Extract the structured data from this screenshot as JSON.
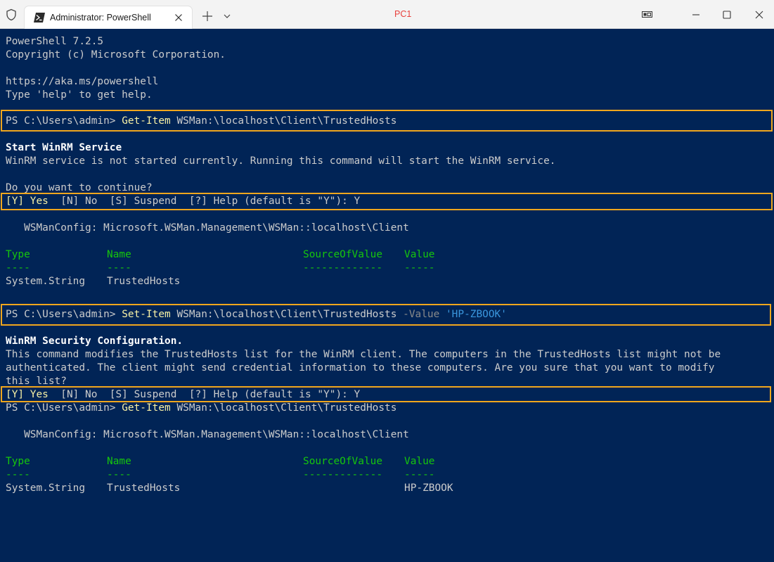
{
  "window": {
    "tab_title": "Administrator: PowerShell",
    "title": "PC1"
  },
  "icons": [
    "shield-icon",
    "powershell-icon",
    "close-icon",
    "plus-icon",
    "chevron-down-icon",
    "snap-icon",
    "minimize-icon",
    "maximize-icon",
    "close-icon"
  ],
  "colors": {
    "background": "#012456",
    "highlight": "#f0a61d",
    "command": "#f9f1a5",
    "header": "#16c60c",
    "string": "#3a96dd",
    "title": "#e8403c"
  },
  "console": {
    "version": "PowerShell 7.2.5",
    "copyright": "Copyright (c) Microsoft Corporation.",
    "url": "https://aka.ms/powershell",
    "help": "Type 'help' to get help.",
    "cmd1": {
      "prompt": "PS C:\\Users\\admin> ",
      "cmdlet": "Get-Item",
      "args": " WSMan:\\localhost\\Client\\TrustedHosts"
    },
    "winrm_title": "Start WinRM Service",
    "winrm_msg": "WinRM service is not started currently. Running this command will start the WinRM service.",
    "continue": "Do you want to continue?",
    "choice1": {
      "yes": "[Y] Yes",
      "rest": "  [N] No  [S] Suspend  [?] Help (default is \"Y\"): Y"
    },
    "wsman1": "   WSManConfig: Microsoft.WSMan.Management\\WSMan::localhost\\Client",
    "table1": {
      "headers": [
        "Type",
        "Name",
        "SourceOfValue",
        "Value"
      ],
      "underlines": [
        "----",
        "----",
        "-------------",
        "-----"
      ],
      "row": [
        "System.String",
        "TrustedHosts",
        "",
        ""
      ]
    },
    "cmd2": {
      "prompt": "PS C:\\Users\\admin> ",
      "cmdlet": "Set-Item",
      "args": " WSMan:\\localhost\\Client\\TrustedHosts ",
      "param": "-Value",
      "value": " 'HP-ZBOOK'"
    },
    "security_title": "WinRM Security Configuration.",
    "security_msg1": "This command modifies the TrustedHosts list for the WinRM client. The computers in the TrustedHosts list might not be",
    "security_msg2": "authenticated. The client might send credential information to these computers. Are you sure that you want to modify",
    "security_msg3": "this list?",
    "choice2": {
      "yes": "[Y] Yes",
      "rest": "  [N] No  [S] Suspend  [?] Help (default is \"Y\"): Y"
    },
    "cmd3": {
      "prompt": "PS C:\\Users\\admin> ",
      "cmdlet": "Get-Item",
      "args": " WSMan:\\localhost\\Client\\TrustedHosts"
    },
    "wsman2": "   WSManConfig: Microsoft.WSMan.Management\\WSMan::localhost\\Client",
    "table2": {
      "headers": [
        "Type",
        "Name",
        "SourceOfValue",
        "Value"
      ],
      "underlines": [
        "----",
        "----",
        "-------------",
        "-----"
      ],
      "row": [
        "System.String",
        "TrustedHosts",
        "",
        "HP-ZBOOK"
      ]
    }
  }
}
